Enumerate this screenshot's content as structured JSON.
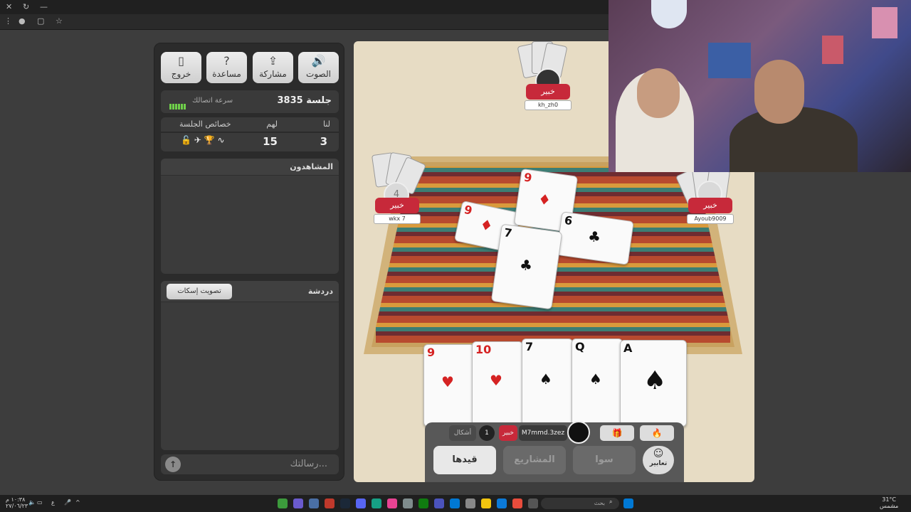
{
  "session": {
    "title": "جلسة 3835",
    "speed_label": "سرعة اتصالك"
  },
  "toolbar": {
    "sound_label": "الصوت",
    "share_label": "مشاركة",
    "help_label": "مساعدة",
    "exit_label": "خروج"
  },
  "score": {
    "us_label": "لنا",
    "them_label": "لهم",
    "props_label": "خصائص الجلسة",
    "us_value": "3",
    "them_value": "15"
  },
  "watchers": {
    "title": "المشاهدون"
  },
  "chat": {
    "title": "دردشة",
    "mute_label": "تصويت إسكات",
    "message_placeholder": "رسالتك..."
  },
  "players": {
    "top": {
      "badge": "خبير",
      "name": "kh_zh0"
    },
    "left": {
      "badge": "خبير",
      "name": "wkx 7",
      "timer": "4"
    },
    "right": {
      "badge": "خبير",
      "name": "Ayoub9009"
    },
    "self": {
      "badge": "خبير",
      "name": "M7mmd.3zez",
      "count": "1",
      "form_label": "أشكال"
    }
  },
  "table_cards": [
    {
      "rank": "9",
      "suit": "♦"
    },
    {
      "rank": "9",
      "suit": "♦"
    },
    {
      "rank": "6",
      "suit": "♣"
    },
    {
      "rank": "7",
      "suit": "♣"
    }
  ],
  "hand": [
    {
      "rank": "9",
      "suit": "♥"
    },
    {
      "rank": "10",
      "suit": "♥"
    },
    {
      "rank": "7",
      "suit": "♠"
    },
    {
      "rank": "Q",
      "suit": "♠"
    },
    {
      "rank": "A",
      "suit": "♠"
    }
  ],
  "actions": {
    "record_label": "قيدها",
    "projects_label": "المشاريع",
    "sawa_label": "سوا",
    "emotes_label": "تعابير"
  },
  "taskbar": {
    "search_placeholder": "بحث",
    "weather": "31°C",
    "weather_desc": "مشمس",
    "time": "١٠:٣٨ م",
    "date": "٢٧/٠٦/٢٣",
    "lang": "ع"
  }
}
